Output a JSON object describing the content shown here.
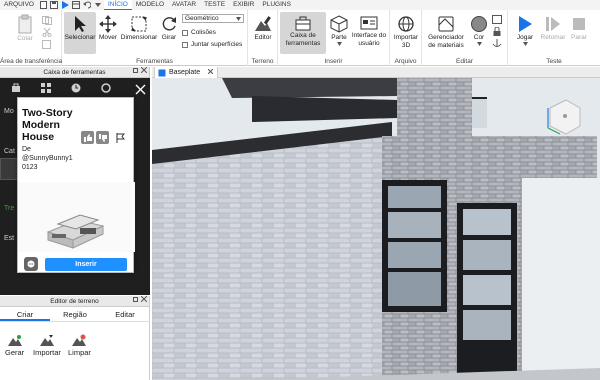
{
  "menubar": {
    "items": [
      {
        "label": "ARQUIVO",
        "active": false
      },
      {
        "label": "INÍCIO",
        "active": true
      },
      {
        "label": "MODELO",
        "active": false
      },
      {
        "label": "AVATAR",
        "active": false
      },
      {
        "label": "TESTE",
        "active": false
      },
      {
        "label": "EXIBIR",
        "active": false
      },
      {
        "label": "PLUGINS",
        "active": false
      }
    ]
  },
  "ribbon": {
    "clipboard": {
      "paste": "Colar",
      "group": "Área de transferência"
    },
    "tools": {
      "select": "Selecionar",
      "move": "Mover",
      "scale": "Dimensionar",
      "rotate": "Girar",
      "group": "Ferramentas",
      "mode": "Geométrico",
      "collisions": "Colisões",
      "join": "Juntar superfícies"
    },
    "terrain": {
      "editor": "Editor",
      "group": "Terreno"
    },
    "insert": {
      "toolbox": "Caixa de ferramentas",
      "part": "Parte",
      "ui": "Interface do usuário",
      "group": "Inserir"
    },
    "file": {
      "import3d": "Importar 3D",
      "group": "Arquivo"
    },
    "edit": {
      "materials": "Gerenciador de materiais",
      "color": "Cor",
      "group": "Editar"
    },
    "test": {
      "play": "Jogar",
      "resume": "Retomar",
      "stop": "Parar",
      "group": "Teste"
    }
  },
  "toolbox": {
    "title": "Caixa de ferramentas",
    "side_labels": [
      "Mo",
      "Cat",
      "Tre",
      "Est"
    ],
    "card": {
      "title": "Two-Story Modern House",
      "by": "De",
      "author": "@SunnyBunny1",
      "extra": "0123",
      "insert": "Inserir"
    }
  },
  "terrain_editor": {
    "title": "Editor de terreno",
    "tabs": [
      {
        "label": "Criar",
        "active": true
      },
      {
        "label": "Região",
        "active": false
      },
      {
        "label": "Editar",
        "active": false
      }
    ],
    "buttons": [
      "Gerar",
      "Importar",
      "Limpar"
    ]
  },
  "viewport": {
    "tab": "Baseplate"
  },
  "colors": {
    "accent": "#1a73e8",
    "insert_button": "#1e90ff",
    "toolbox_bg": "#1f1f1f"
  }
}
